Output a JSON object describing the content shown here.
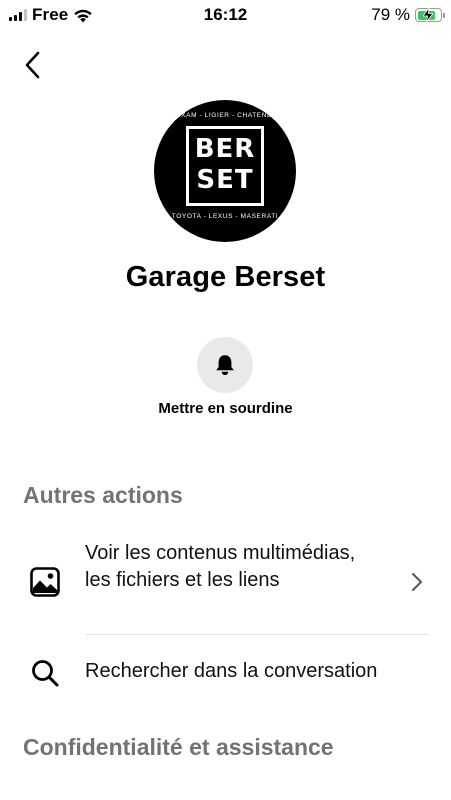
{
  "status_bar": {
    "carrier": "Free",
    "time": "16:12",
    "battery_percent": "79 %",
    "battery_level": 0.79
  },
  "profile": {
    "avatar_top_text": "RIXAM - LIGIER - CHATENET",
    "avatar_logo_line1": "BER",
    "avatar_logo_line2": "SET",
    "avatar_bottom_text": "TOYOTA - LEXUS - MASERATI",
    "name": "Garage Berset"
  },
  "mute": {
    "label": "Mettre en sourdine",
    "icon": "bell-icon"
  },
  "sections": {
    "other_actions": {
      "title": "Autres actions",
      "items": [
        {
          "label": "Voir les contenus multimédias, les fichiers et les liens",
          "icon": "image-icon"
        },
        {
          "label": "Rechercher dans la conversation",
          "icon": "search-icon"
        }
      ]
    },
    "privacy": {
      "title": "Confidentialité et assistance"
    }
  },
  "colors": {
    "section_title": "#737373",
    "battery": "#35c759",
    "mute_bg": "#e9e9eb"
  }
}
